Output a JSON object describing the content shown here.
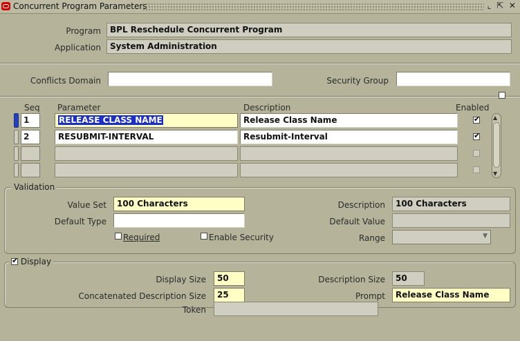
{
  "window": {
    "title": "Concurrent Program Parameters",
    "controls": "⌞ ⇱ ✕"
  },
  "header": {
    "program_label": "Program",
    "program_value": "BPL Reschedule Concurrent Program",
    "application_label": "Application",
    "application_value": "System Administration",
    "conflicts_label": "Conflicts Domain",
    "conflicts_value": "",
    "security_label": "Security Group",
    "security_value": ""
  },
  "grid": {
    "columns": {
      "seq": "Seq",
      "parameter": "Parameter",
      "description": "Description",
      "enabled": "Enabled"
    },
    "rows": [
      {
        "seq": "1",
        "parameter": "RELEASE CLASS NAME",
        "description": "Release Class Name",
        "enabled": true,
        "active": true
      },
      {
        "seq": "2",
        "parameter": "RESUBMIT-INTERVAL",
        "description": "Resubmit-Interval",
        "enabled": true,
        "active": false
      },
      {
        "seq": "",
        "parameter": "",
        "description": "",
        "enabled": false,
        "active": false
      },
      {
        "seq": "",
        "parameter": "",
        "description": "",
        "enabled": false,
        "active": false
      }
    ]
  },
  "validation": {
    "legend": "Validation",
    "value_set_label": "Value Set",
    "value_set_value": "100 Characters",
    "default_type_label": "Default Type",
    "default_type_value": "",
    "required_label": "Required",
    "enable_security_label": "Enable Security",
    "description_label": "Description",
    "description_value": "100 Characters",
    "default_value_label": "Default Value",
    "default_value_value": "",
    "range_label": "Range",
    "range_value": ""
  },
  "display": {
    "legend": "Display",
    "checked": true,
    "display_size_label": "Display Size",
    "display_size_value": "50",
    "concat_size_label": "Concatenated Description Size",
    "concat_size_value": "25",
    "desc_size_label": "Description Size",
    "desc_size_value": "50",
    "prompt_label": "Prompt",
    "prompt_value": "Release Class Name"
  },
  "token": {
    "label": "Token",
    "value": ""
  }
}
